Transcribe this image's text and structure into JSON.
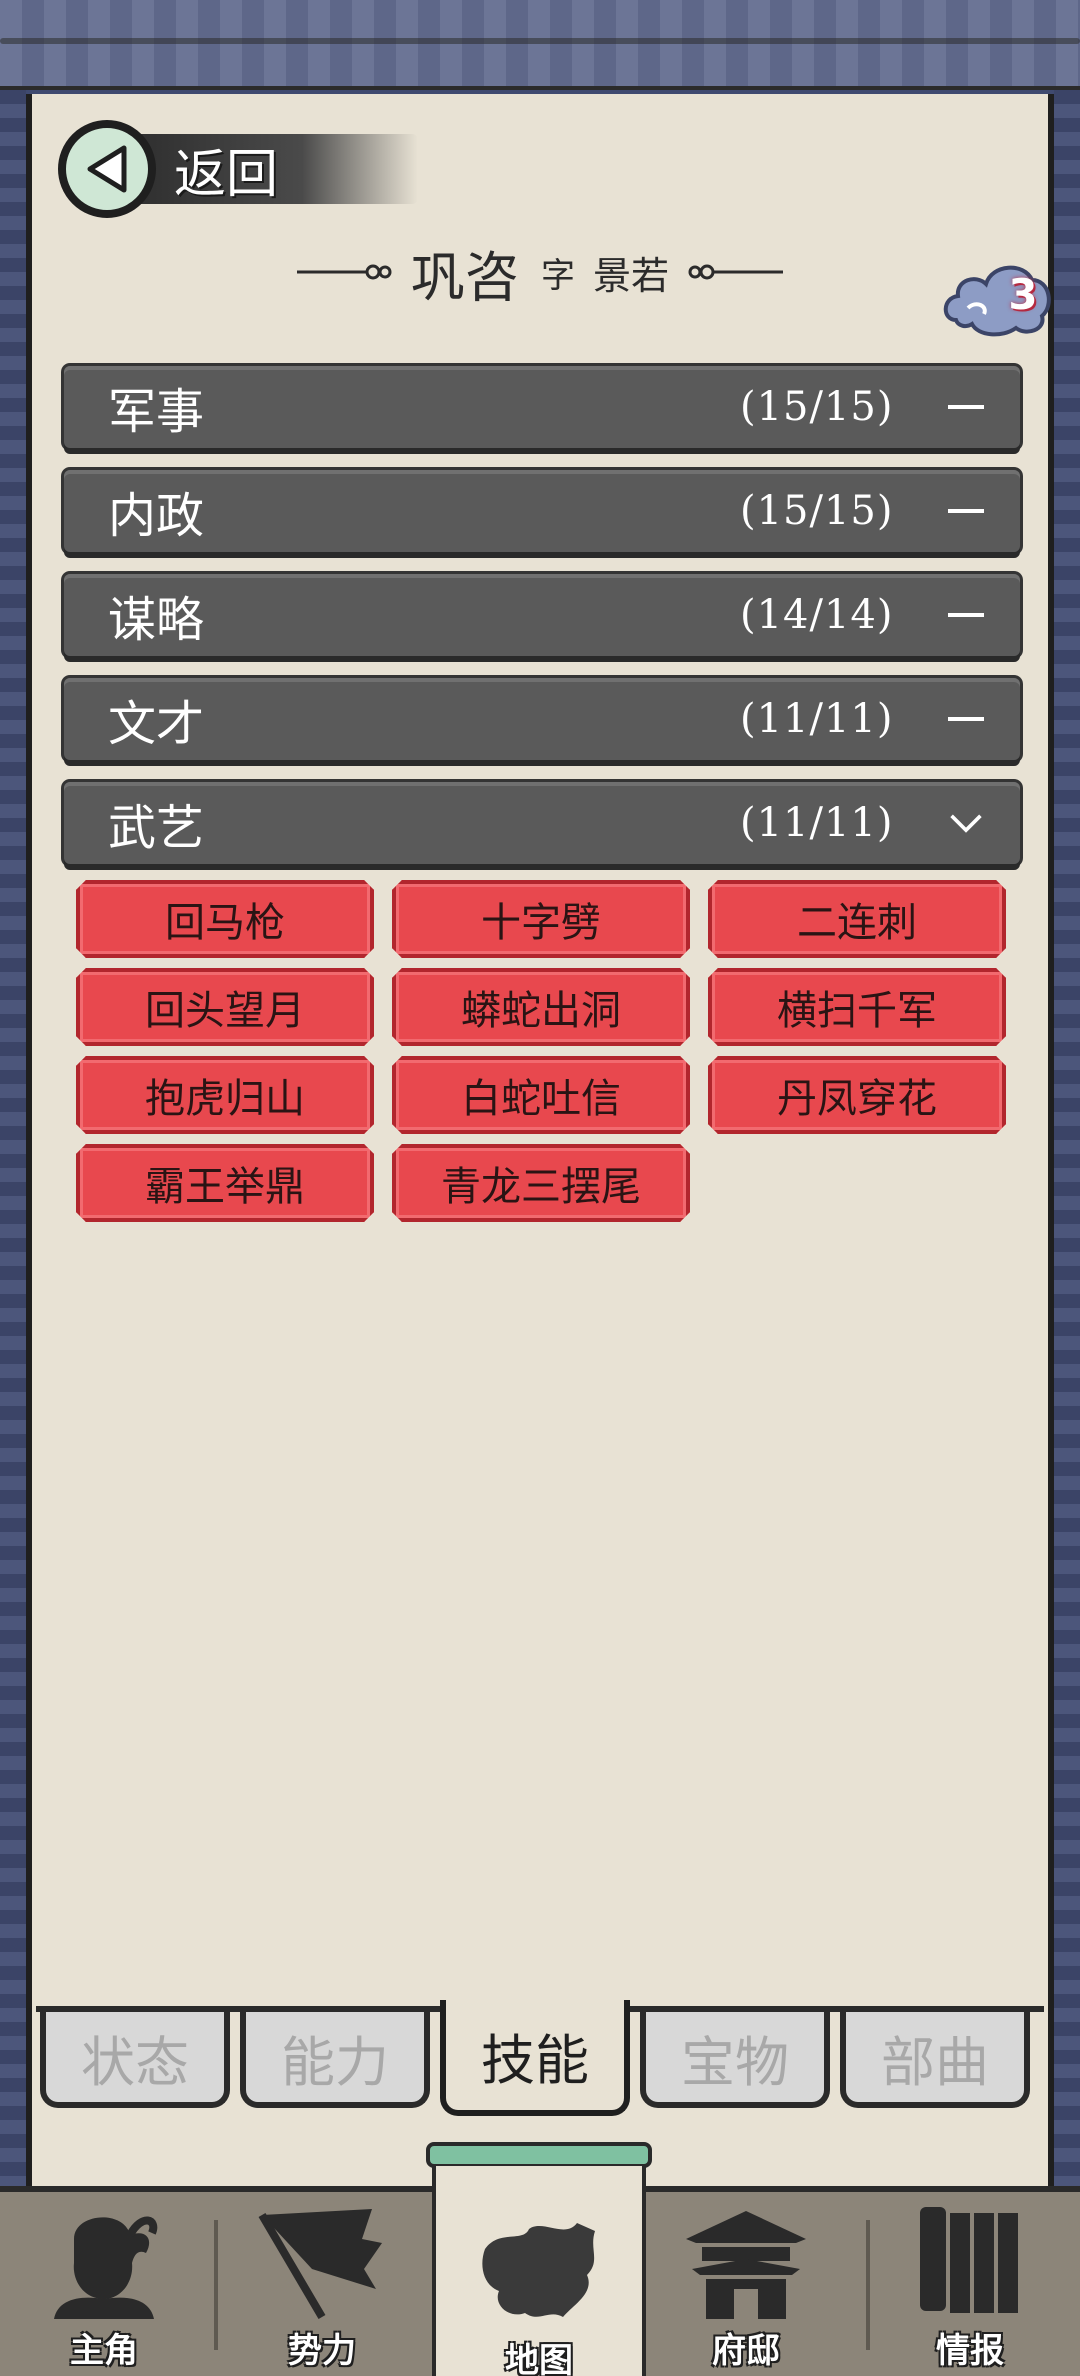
{
  "header": {
    "back_label": "返回",
    "title_name": "巩咨",
    "title_zi": "字",
    "title_courtesy": "景若",
    "badge_count": "3"
  },
  "categories": [
    {
      "name": "军事",
      "count": "(15/15)",
      "state": "collapsed"
    },
    {
      "name": "内政",
      "count": "(15/15)",
      "state": "collapsed"
    },
    {
      "name": "谋略",
      "count": "(14/14)",
      "state": "collapsed"
    },
    {
      "name": "文才",
      "count": "(11/11)",
      "state": "collapsed"
    },
    {
      "name": "武艺",
      "count": "(11/11)",
      "state": "expanded"
    }
  ],
  "skills": [
    "回马枪",
    "十字劈",
    "二连刺",
    "回头望月",
    "蟒蛇出洞",
    "横扫千军",
    "抱虎归山",
    "白蛇吐信",
    "丹凤穿花",
    "霸王举鼎",
    "青龙三摆尾"
  ],
  "subtabs": [
    {
      "label": "状态",
      "active": false
    },
    {
      "label": "能力",
      "active": false
    },
    {
      "label": "技能",
      "active": true
    },
    {
      "label": "宝物",
      "active": false
    },
    {
      "label": "部曲",
      "active": false
    }
  ],
  "bottom_nav": [
    {
      "label": "主角",
      "icon": "hero-icon",
      "active": false
    },
    {
      "label": "势力",
      "icon": "flag-icon",
      "active": false
    },
    {
      "label": "地图",
      "icon": "map-icon",
      "active": true
    },
    {
      "label": "府邸",
      "icon": "mansion-icon",
      "active": false
    },
    {
      "label": "情报",
      "icon": "scroll-icon",
      "active": false
    }
  ],
  "colors": {
    "skill_red": "#e8484e",
    "category_bar": "#5a5a5a",
    "paper": "#e8e2d4",
    "frame_blue": "#4c567b"
  }
}
